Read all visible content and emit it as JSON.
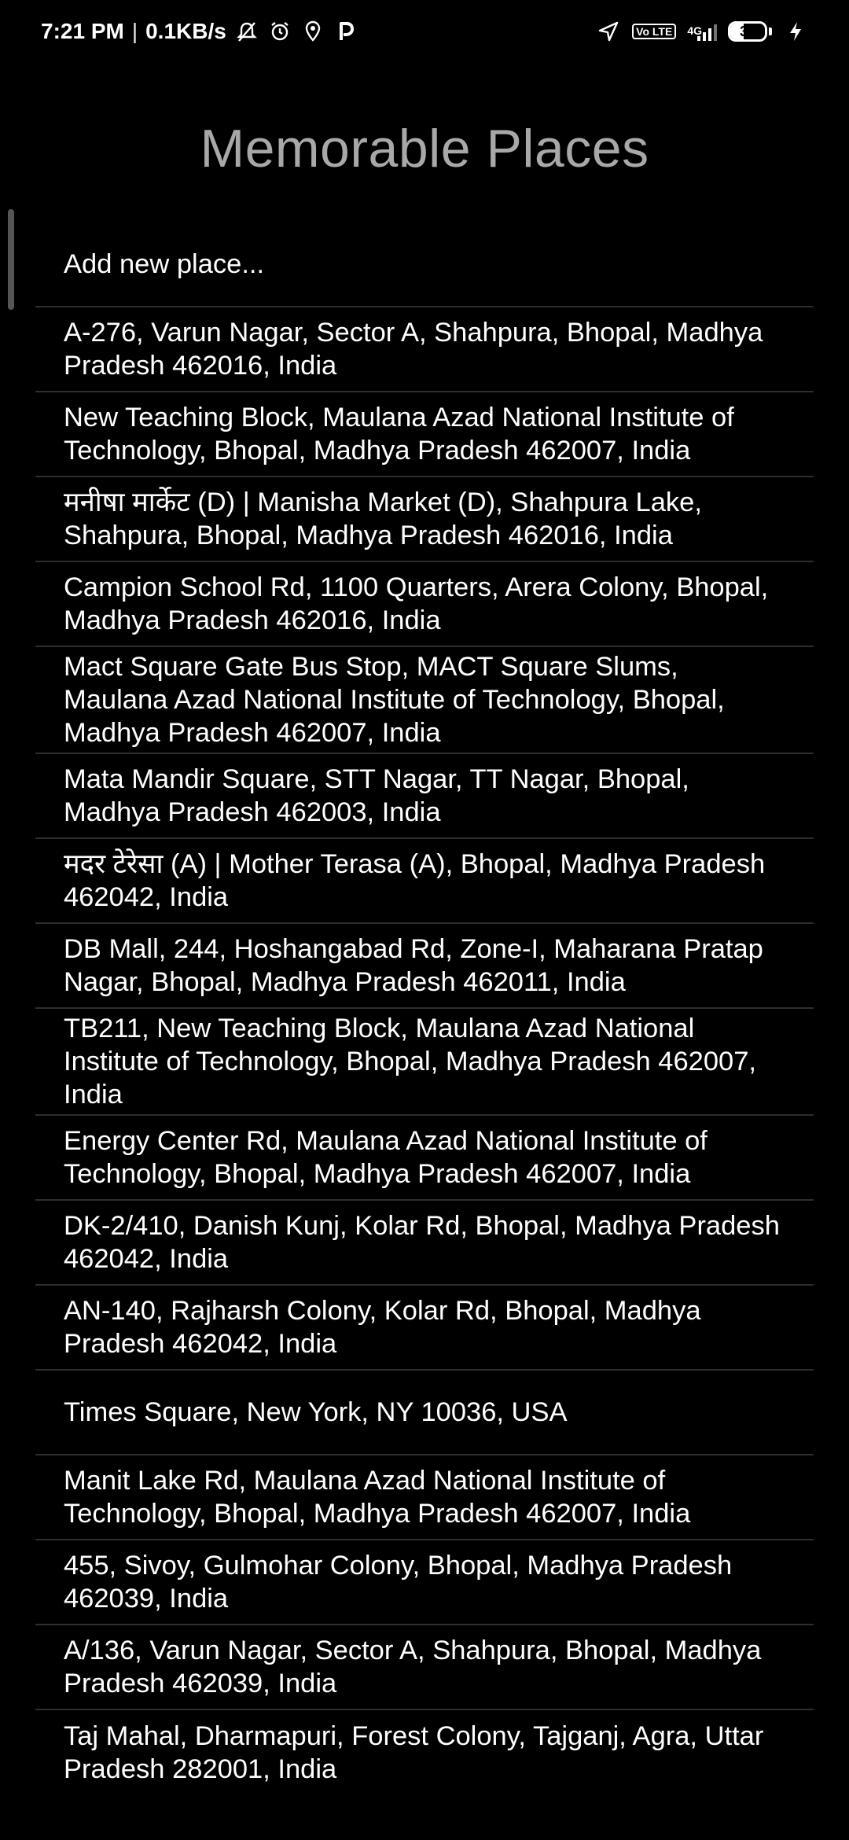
{
  "status_bar": {
    "time": "7:21 PM",
    "network_speed": "0.1KB/s",
    "icons": [
      "muted-notification-icon",
      "alarm-icon",
      "location-pin-icon",
      "parking-p-icon"
    ],
    "right_icons": [
      "navigation-arrow-icon",
      "volte-icon",
      "signal-4g-icon",
      "battery-icon",
      "charging-bolt-icon"
    ],
    "volte_label": "Vo LTE",
    "net_type": "4G",
    "battery_level": "39",
    "battery_percent": 0.39
  },
  "title": "Memorable Places",
  "places": [
    "Add new place...",
    "A-276, Varun Nagar, Sector A, Shahpura, Bhopal, Madhya Pradesh 462016, India",
    "New Teaching Block, Maulana Azad National Institute of Technology, Bhopal, Madhya Pradesh 462007, India",
    "मनीषा मार्केट (D) | Manisha Market (D), Shahpura Lake, Shahpura, Bhopal, Madhya Pradesh 462016, India",
    "Campion School Rd, 1100 Quarters, Arera Colony, Bhopal, Madhya Pradesh 462016, India",
    "Mact Square Gate Bus Stop, MACT Square Slums, Maulana Azad National Institute of Technology, Bhopal, Madhya Pradesh 462007, India",
    "Mata Mandir Square, STT Nagar, TT Nagar, Bhopal, Madhya Pradesh 462003, India",
    "मदर टेरेसा (A) | Mother Terasa (A), Bhopal, Madhya Pradesh 462042, India",
    "DB Mall, 244, Hoshangabad Rd, Zone-I, Maharana Pratap Nagar, Bhopal, Madhya Pradesh 462011, India",
    "TB211, New Teaching Block, Maulana Azad National Institute of Technology, Bhopal, Madhya Pradesh 462007, India",
    "Energy Center Rd, Maulana Azad National Institute of Technology, Bhopal, Madhya Pradesh 462007, India",
    "DK-2/410, Danish Kunj, Kolar Rd, Bhopal, Madhya Pradesh 462042, India",
    "AN-140, Rajharsh Colony, Kolar Rd, Bhopal, Madhya Pradesh 462042, India",
    "Times Square, New York, NY 10036, USA",
    "Manit Lake Rd, Maulana Azad National Institute of Technology, Bhopal, Madhya Pradesh 462007, India",
    "455, Sivoy, Gulmohar Colony, Bhopal, Madhya Pradesh 462039, India",
    "A/136, Varun Nagar, Sector A, Shahpura, Bhopal, Madhya Pradesh 462039, India",
    "Taj Mahal, Dharmapuri, Forest Colony, Tajganj, Agra, Uttar Pradesh 282001, India"
  ]
}
